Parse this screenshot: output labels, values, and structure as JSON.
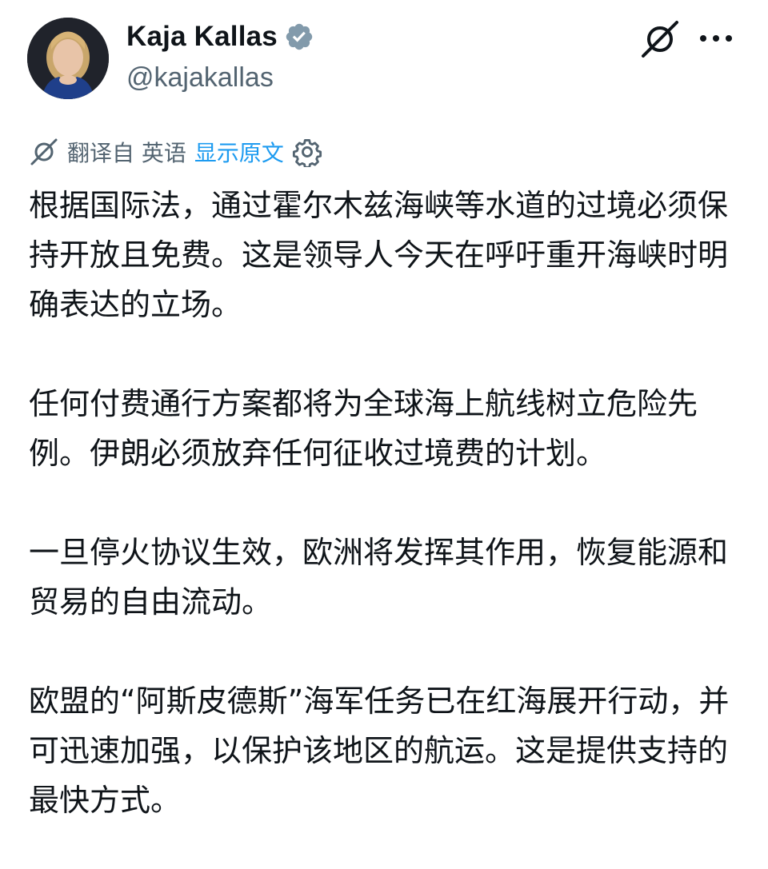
{
  "author": {
    "display_name": "Kaja Kallas",
    "handle": "@kajakallas",
    "verified_icon": "verified-badge-icon",
    "avatar_icon": "avatar-photo"
  },
  "actions": {
    "grok_icon": "grok-icon",
    "more_icon": "more-horizontal-icon"
  },
  "translation": {
    "icon": "translate-icon",
    "translated_from": "翻译自 英语",
    "show_original": "显示原文",
    "settings_icon": "gear-icon"
  },
  "tweet": {
    "paragraphs": [
      "根据国际法，通过霍尔木兹海峡等水道的过境必须保持开放且免费。这是领导人今天在呼吁重开海峡时明确表达的立场。",
      "任何付费通行方案都将为全球海上航线树立危险先例。伊朗必须放弃任何征收过境费的计划。",
      "一旦停火协议生效，欧洲将发挥其作用，恢复能源和贸易的自由流动。",
      "欧盟的“阿斯皮德斯”海军任务已在红海展开行动，并可迅速加强，以保护该地区的航运。这是提供支持的最快方式。"
    ]
  },
  "colors": {
    "text": "#0f1419",
    "secondary": "#536471",
    "link": "#1d9bf0",
    "verified": "#829aab"
  }
}
